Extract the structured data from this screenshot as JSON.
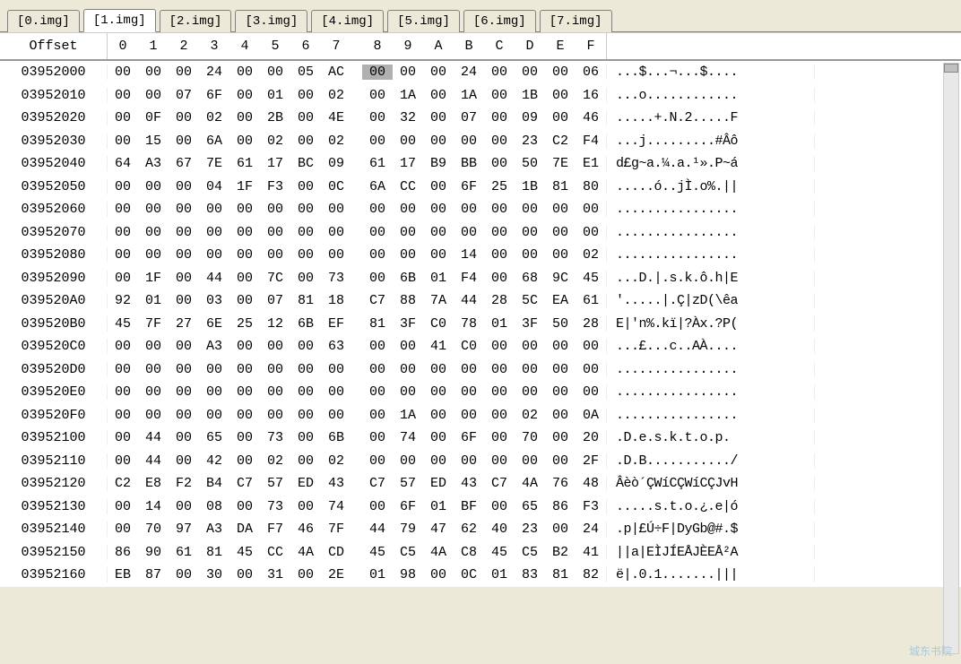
{
  "tabs": [
    {
      "label": "[0.img]"
    },
    {
      "label": "[1.img]"
    },
    {
      "label": "[2.img]"
    },
    {
      "label": "[3.img]"
    },
    {
      "label": "[4.img]"
    },
    {
      "label": "[5.img]"
    },
    {
      "label": "[6.img]"
    },
    {
      "label": "[7.img]"
    }
  ],
  "active_tab": 1,
  "header": {
    "offset": "Offset",
    "cols": [
      "0",
      "1",
      "2",
      "3",
      "4",
      "5",
      "6",
      "7",
      "8",
      "9",
      "A",
      "B",
      "C",
      "D",
      "E",
      "F"
    ]
  },
  "selected": {
    "row": 0,
    "col": 8
  },
  "rows": [
    {
      "offset": "03952000",
      "hex": [
        "00",
        "00",
        "00",
        "24",
        "00",
        "00",
        "05",
        "AC",
        "00",
        "00",
        "00",
        "24",
        "00",
        "00",
        "00",
        "06"
      ],
      "ascii": "...$...¬...$...."
    },
    {
      "offset": "03952010",
      "hex": [
        "00",
        "00",
        "07",
        "6F",
        "00",
        "01",
        "00",
        "02",
        "00",
        "1A",
        "00",
        "1A",
        "00",
        "1B",
        "00",
        "16"
      ],
      "ascii": "...o............"
    },
    {
      "offset": "03952020",
      "hex": [
        "00",
        "0F",
        "00",
        "02",
        "00",
        "2B",
        "00",
        "4E",
        "00",
        "32",
        "00",
        "07",
        "00",
        "09",
        "00",
        "46"
      ],
      "ascii": ".....+.N.2.....F"
    },
    {
      "offset": "03952030",
      "hex": [
        "00",
        "15",
        "00",
        "6A",
        "00",
        "02",
        "00",
        "02",
        "00",
        "00",
        "00",
        "00",
        "00",
        "23",
        "C2",
        "F4"
      ],
      "ascii": "...j.........#Âô"
    },
    {
      "offset": "03952040",
      "hex": [
        "64",
        "A3",
        "67",
        "7E",
        "61",
        "17",
        "BC",
        "09",
        "61",
        "17",
        "B9",
        "BB",
        "00",
        "50",
        "7E",
        "E1"
      ],
      "ascii": "d£g~a.¼.a.¹».P~á"
    },
    {
      "offset": "03952050",
      "hex": [
        "00",
        "00",
        "00",
        "04",
        "1F",
        "F3",
        "00",
        "0C",
        "6A",
        "CC",
        "00",
        "6F",
        "25",
        "1B",
        "81",
        "80"
      ],
      "ascii": ".....ó..jÌ.o%.||"
    },
    {
      "offset": "03952060",
      "hex": [
        "00",
        "00",
        "00",
        "00",
        "00",
        "00",
        "00",
        "00",
        "00",
        "00",
        "00",
        "00",
        "00",
        "00",
        "00",
        "00"
      ],
      "ascii": "................"
    },
    {
      "offset": "03952070",
      "hex": [
        "00",
        "00",
        "00",
        "00",
        "00",
        "00",
        "00",
        "00",
        "00",
        "00",
        "00",
        "00",
        "00",
        "00",
        "00",
        "00"
      ],
      "ascii": "................"
    },
    {
      "offset": "03952080",
      "hex": [
        "00",
        "00",
        "00",
        "00",
        "00",
        "00",
        "00",
        "00",
        "00",
        "00",
        "00",
        "14",
        "00",
        "00",
        "00",
        "02"
      ],
      "ascii": "................"
    },
    {
      "offset": "03952090",
      "hex": [
        "00",
        "1F",
        "00",
        "44",
        "00",
        "7C",
        "00",
        "73",
        "00",
        "6B",
        "01",
        "F4",
        "00",
        "68",
        "9C",
        "45"
      ],
      "ascii": "...D.|.s.k.ô.h|E"
    },
    {
      "offset": "039520A0",
      "hex": [
        "92",
        "01",
        "00",
        "03",
        "00",
        "07",
        "81",
        "18",
        "C7",
        "88",
        "7A",
        "44",
        "28",
        "5C",
        "EA",
        "61"
      ],
      "ascii": "'.....|.Ç|zD(\\êa"
    },
    {
      "offset": "039520B0",
      "hex": [
        "45",
        "7F",
        "27",
        "6E",
        "25",
        "12",
        "6B",
        "EF",
        "81",
        "3F",
        "C0",
        "78",
        "01",
        "3F",
        "50",
        "28"
      ],
      "ascii": "E|'n%.kï|?Àx.?P("
    },
    {
      "offset": "039520C0",
      "hex": [
        "00",
        "00",
        "00",
        "A3",
        "00",
        "00",
        "00",
        "63",
        "00",
        "00",
        "41",
        "C0",
        "00",
        "00",
        "00",
        "00"
      ],
      "ascii": "...£...c..AÀ...."
    },
    {
      "offset": "039520D0",
      "hex": [
        "00",
        "00",
        "00",
        "00",
        "00",
        "00",
        "00",
        "00",
        "00",
        "00",
        "00",
        "00",
        "00",
        "00",
        "00",
        "00"
      ],
      "ascii": "................"
    },
    {
      "offset": "039520E0",
      "hex": [
        "00",
        "00",
        "00",
        "00",
        "00",
        "00",
        "00",
        "00",
        "00",
        "00",
        "00",
        "00",
        "00",
        "00",
        "00",
        "00"
      ],
      "ascii": "................"
    },
    {
      "offset": "039520F0",
      "hex": [
        "00",
        "00",
        "00",
        "00",
        "00",
        "00",
        "00",
        "00",
        "00",
        "1A",
        "00",
        "00",
        "00",
        "02",
        "00",
        "0A"
      ],
      "ascii": "................"
    },
    {
      "offset": "03952100",
      "hex": [
        "00",
        "44",
        "00",
        "65",
        "00",
        "73",
        "00",
        "6B",
        "00",
        "74",
        "00",
        "6F",
        "00",
        "70",
        "00",
        "20"
      ],
      "ascii": ".D.e.s.k.t.o.p. "
    },
    {
      "offset": "03952110",
      "hex": [
        "00",
        "44",
        "00",
        "42",
        "00",
        "02",
        "00",
        "02",
        "00",
        "00",
        "00",
        "00",
        "00",
        "00",
        "00",
        "2F"
      ],
      "ascii": ".D.B.........../"
    },
    {
      "offset": "03952120",
      "hex": [
        "C2",
        "E8",
        "F2",
        "B4",
        "C7",
        "57",
        "ED",
        "43",
        "C7",
        "57",
        "ED",
        "43",
        "C7",
        "4A",
        "76",
        "48"
      ],
      "ascii": "Âèò´ÇWíCÇWíCÇJvH"
    },
    {
      "offset": "03952130",
      "hex": [
        "00",
        "14",
        "00",
        "08",
        "00",
        "73",
        "00",
        "74",
        "00",
        "6F",
        "01",
        "BF",
        "00",
        "65",
        "86",
        "F3"
      ],
      "ascii": ".....s.t.o.¿.e|ó"
    },
    {
      "offset": "03952140",
      "hex": [
        "00",
        "70",
        "97",
        "A3",
        "DA",
        "F7",
        "46",
        "7F",
        "44",
        "79",
        "47",
        "62",
        "40",
        "23",
        "00",
        "24"
      ],
      "ascii": ".p|£Ú÷F|DyGb@#.$"
    },
    {
      "offset": "03952150",
      "hex": [
        "86",
        "90",
        "61",
        "81",
        "45",
        "CC",
        "4A",
        "CD",
        "45",
        "C5",
        "4A",
        "C8",
        "45",
        "C5",
        "B2",
        "41"
      ],
      "ascii": "||a|EÌJÍEÅJÈEÅ²A"
    },
    {
      "offset": "03952160",
      "hex": [
        "EB",
        "87",
        "00",
        "30",
        "00",
        "31",
        "00",
        "2E",
        "01",
        "98",
        "00",
        "0C",
        "01",
        "83",
        "81",
        "82"
      ],
      "ascii": "ë|.0.1.......|||"
    }
  ],
  "watermark": "城东书院"
}
